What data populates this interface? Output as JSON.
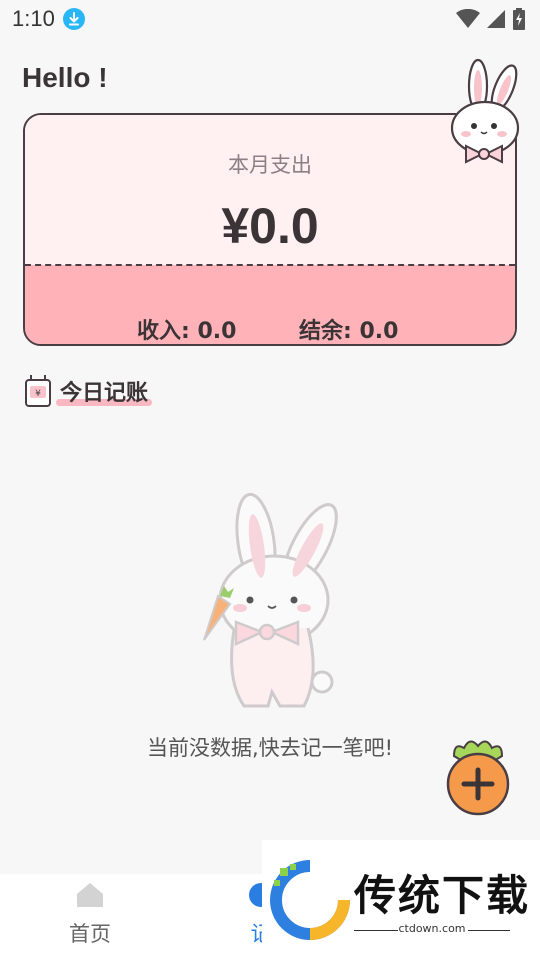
{
  "status_bar": {
    "time": "1:10"
  },
  "header": {
    "greeting": "Hello !"
  },
  "summary": {
    "month_label": "本月支出",
    "month_amount": "¥0.0",
    "income": "收入: 0.0",
    "balance": "结余: 0.0"
  },
  "section": {
    "title": "今日记账"
  },
  "empty_state": {
    "message": "当前没数据,快去记一笔吧!"
  },
  "bottom_nav": {
    "home_label": "首页",
    "record_label": "记"
  },
  "watermark": {
    "name": "传统下载",
    "site": "ctdown.com"
  },
  "colors": {
    "card_top": "#fff0f2",
    "card_bottom": "#ffb3b8",
    "accent_blue": "#2a7de1",
    "carrot": "#f59a4b"
  },
  "icons": [
    "download-icon",
    "wifi-icon",
    "signal-icon",
    "battery-icon",
    "bunny-icon",
    "wallet-icon",
    "add-icon",
    "home-icon"
  ]
}
